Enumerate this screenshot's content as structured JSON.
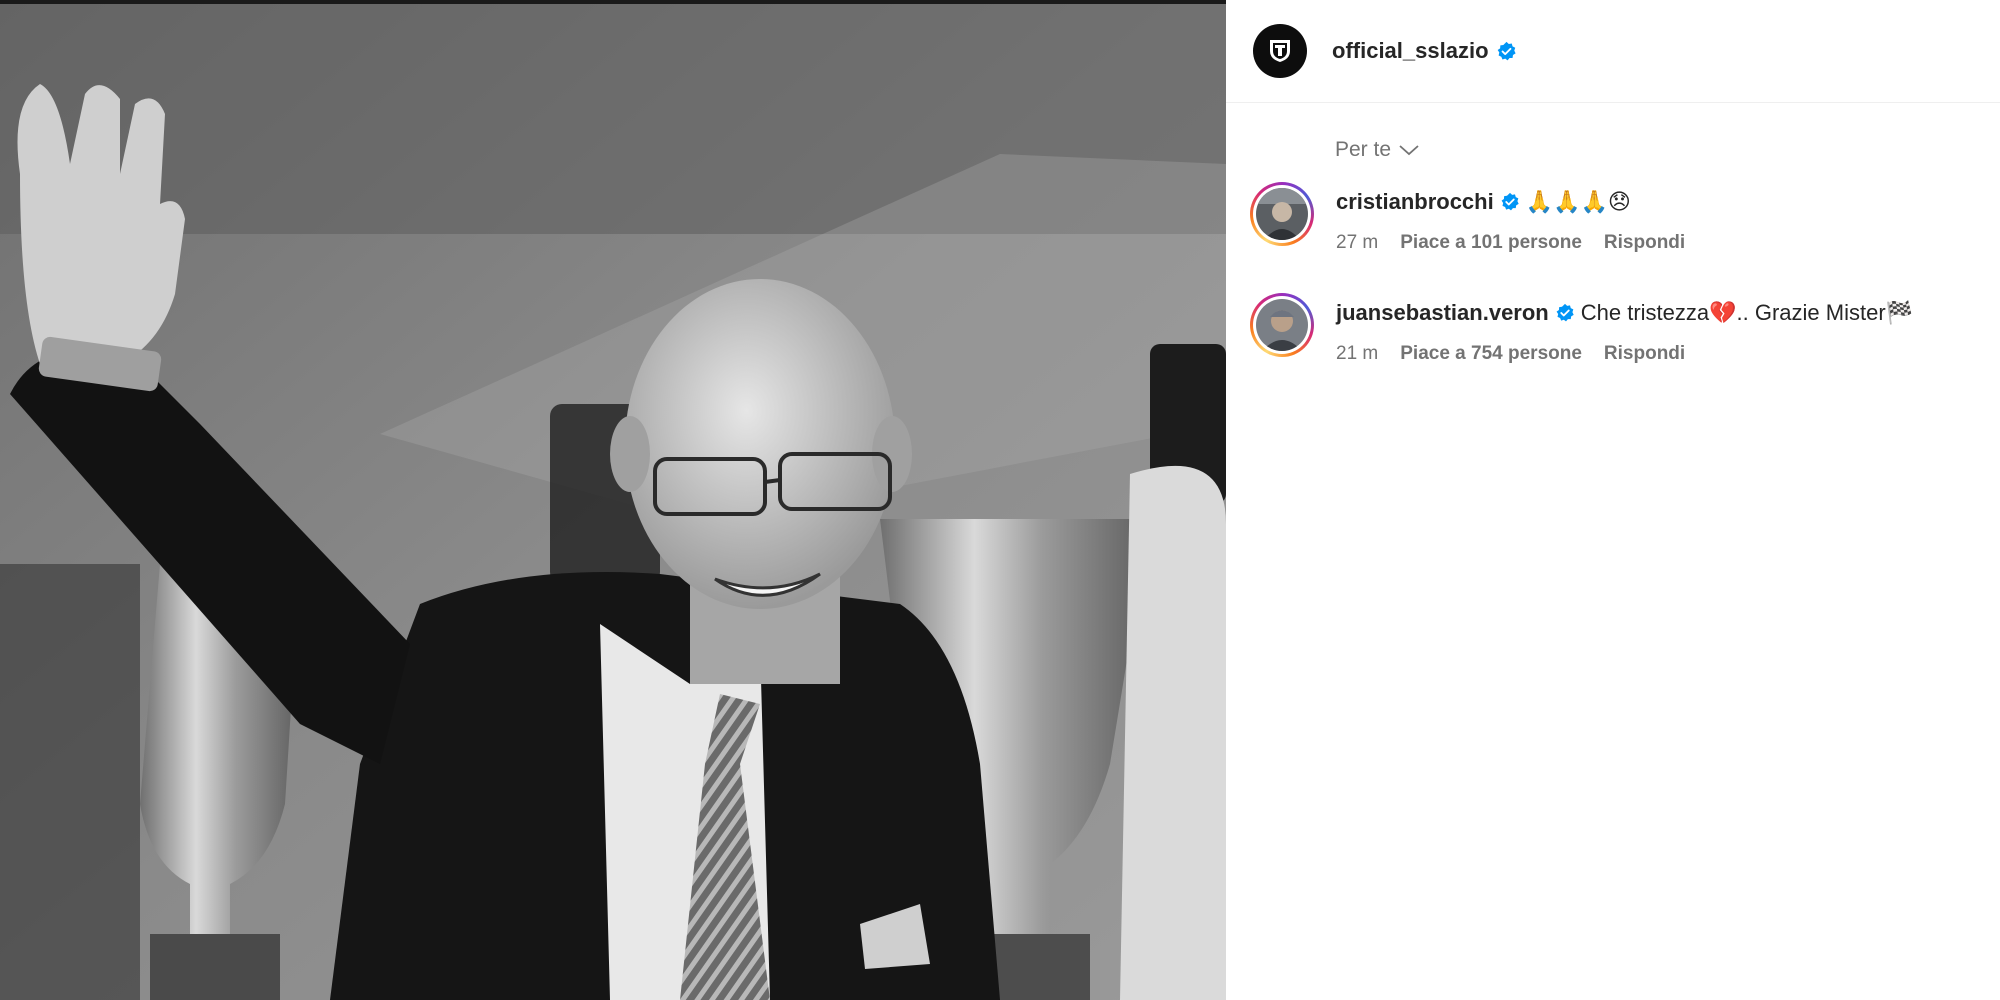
{
  "post": {
    "author": "official_sslazio",
    "verified": true,
    "photo_icon": "black-and-white-photo-man-waving-with-trophies"
  },
  "comments_section": {
    "sort_label": "Per te",
    "comments": [
      {
        "username": "cristianbrocchi",
        "verified": true,
        "text": "🙏🙏🙏😞",
        "time": "27 m",
        "likes": "Piace a 101 persone",
        "reply": "Rispondi"
      },
      {
        "username": "juansebastian.veron",
        "verified": true,
        "text": "Che tristezza💔.. Grazie Mister🏁",
        "time": "21 m",
        "likes": "Piace a 754 persone",
        "reply": "Rispondi"
      }
    ]
  },
  "colors": {
    "verified_badge": "#0095f6",
    "meta_text": "#737373"
  }
}
